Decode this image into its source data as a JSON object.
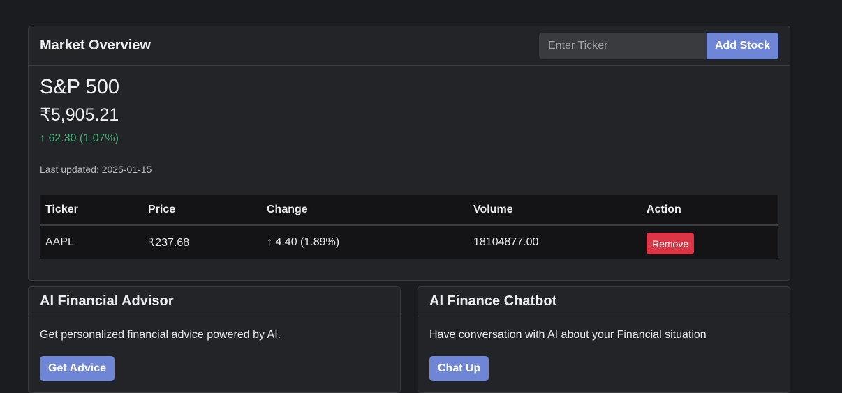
{
  "market_overview": {
    "title": "Market Overview",
    "ticker_placeholder": "Enter Ticker",
    "add_button": "Add Stock",
    "index": {
      "name": "S&P 500",
      "price": "₹5,905.21",
      "change": "↑ 62.30 (1.07%)",
      "change_color": "#3fae77"
    },
    "last_updated": "Last updated: 2025-01-15",
    "table": {
      "headers": [
        "Ticker",
        "Price",
        "Change",
        "Volume",
        "Action"
      ],
      "rows": [
        {
          "ticker": "AAPL",
          "price": "₹237.68",
          "change": "↑ 4.40 (1.89%)",
          "volume": "18104877.00",
          "action": "Remove"
        }
      ]
    }
  },
  "advisor": {
    "title": "AI Financial Advisor",
    "description": "Get personalized financial advice powered by AI.",
    "button": "Get Advice"
  },
  "chatbot": {
    "title": "AI Finance Chatbot",
    "description": "Have conversation with AI about your Financial situation",
    "button": "Chat Up"
  },
  "colors": {
    "background": "#1b1c1f",
    "card": "#232427",
    "accent": "#6f86d6",
    "danger": "#dc3545",
    "positive": "#3fae77"
  }
}
